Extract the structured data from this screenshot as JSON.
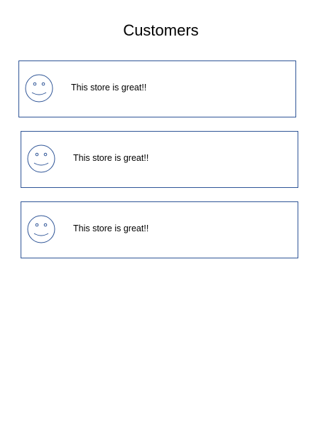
{
  "page": {
    "title": "Customers"
  },
  "colors": {
    "accent": "#2f5597"
  },
  "reviews": [
    {
      "icon": "smiley-face-icon",
      "text": "This store is great!!"
    },
    {
      "icon": "smiley-face-icon",
      "text": "This store is great!!"
    },
    {
      "icon": "smiley-face-icon",
      "text": "This store is great!!"
    }
  ]
}
